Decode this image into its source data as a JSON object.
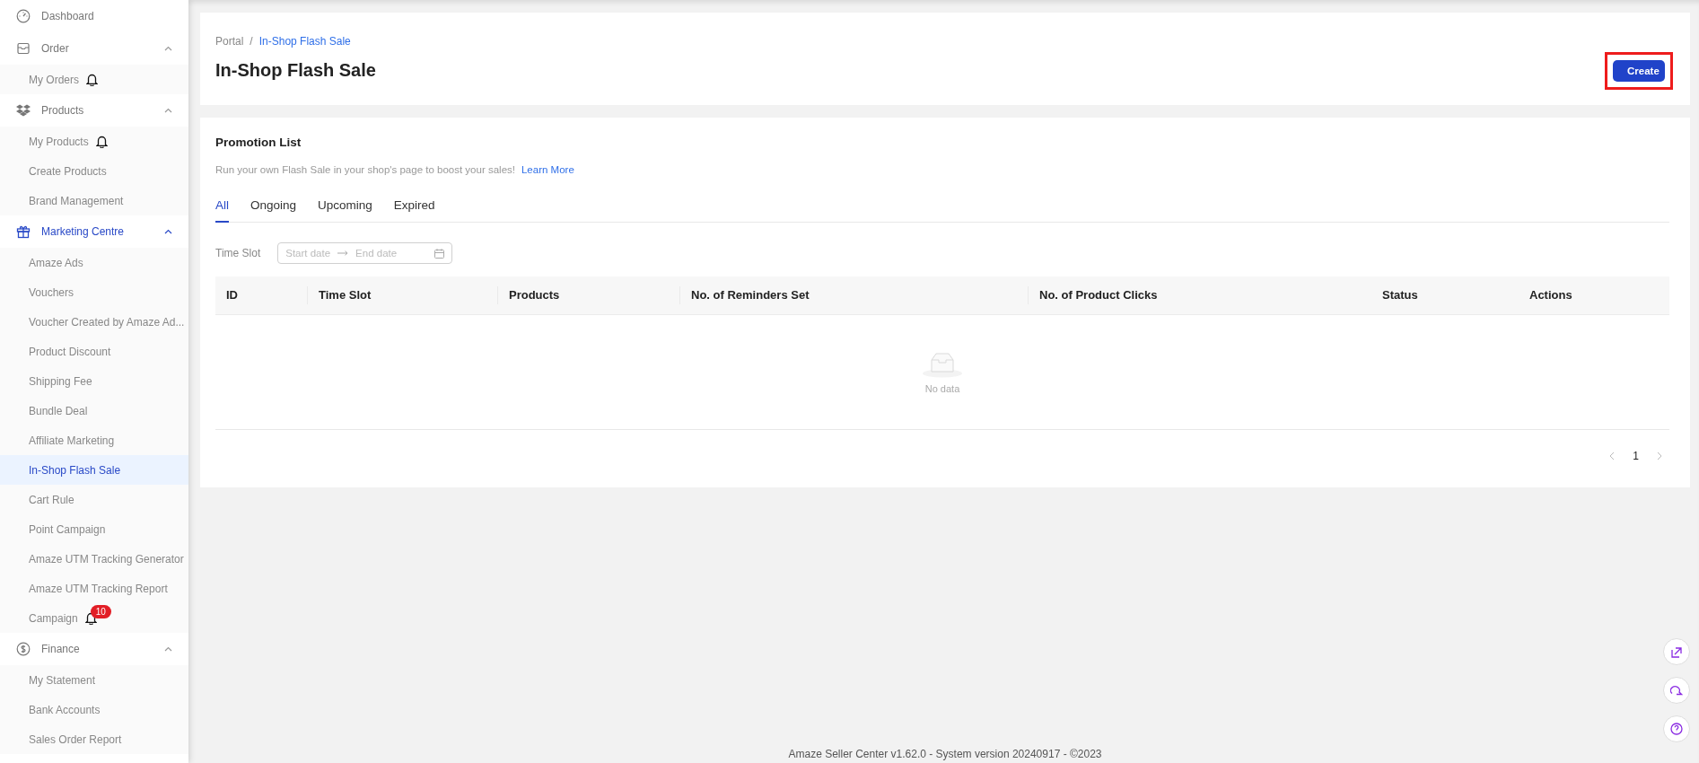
{
  "sidebar": {
    "items": [
      {
        "label": "Dashboard",
        "active": false
      },
      {
        "label": "Order",
        "expanded": true,
        "active": false,
        "children": [
          {
            "label": "My Orders",
            "selected": false,
            "bell": true
          }
        ]
      },
      {
        "label": "Products",
        "expanded": true,
        "active": false,
        "children": [
          {
            "label": "My Products",
            "selected": false,
            "bell": true
          },
          {
            "label": "Create Products",
            "selected": false,
            "bell": false
          },
          {
            "label": "Brand Management",
            "selected": false,
            "bell": false
          }
        ]
      },
      {
        "label": "Marketing Centre",
        "expanded": true,
        "active": true,
        "children": [
          {
            "label": "Amaze Ads",
            "selected": false,
            "bell": false
          },
          {
            "label": "Vouchers",
            "selected": false,
            "bell": false
          },
          {
            "label": "Voucher Created by Amaze Ad...",
            "selected": false,
            "bell": false
          },
          {
            "label": "Product Discount",
            "selected": false,
            "bell": false
          },
          {
            "label": "Shipping Fee",
            "selected": false,
            "bell": false
          },
          {
            "label": "Bundle Deal",
            "selected": false,
            "bell": false
          },
          {
            "label": "Affiliate Marketing",
            "selected": false,
            "bell": false
          },
          {
            "label": "In-Shop Flash Sale",
            "selected": true,
            "bell": false
          },
          {
            "label": "Cart Rule",
            "selected": false,
            "bell": false
          },
          {
            "label": "Point Campaign",
            "selected": false,
            "bell": false
          },
          {
            "label": "Amaze UTM Tracking Generator",
            "selected": false,
            "bell": false
          },
          {
            "label": "Amaze UTM Tracking Report",
            "selected": false,
            "bell": false
          },
          {
            "label": "Campaign",
            "selected": false,
            "bell": true,
            "badge": "10"
          }
        ]
      },
      {
        "label": "Finance",
        "expanded": true,
        "active": false,
        "children": [
          {
            "label": "My Statement",
            "selected": false,
            "bell": false
          },
          {
            "label": "Bank Accounts",
            "selected": false,
            "bell": false
          },
          {
            "label": "Sales Order Report",
            "selected": false,
            "bell": false
          }
        ]
      }
    ]
  },
  "header": {
    "breadcrumb": [
      "Portal",
      "In-Shop Flash Sale"
    ],
    "breadcrumb_separator": "/",
    "title": "In-Shop Flash Sale",
    "create_button": {
      "label": "Create",
      "highlighted": true
    }
  },
  "promotion_list": {
    "title": "Promotion List",
    "description": "Run your own Flash Sale in your shop's page to boost your sales!",
    "link": "Learn More",
    "tabs": [
      {
        "label": "All",
        "selected": true
      },
      {
        "label": "Ongoing",
        "selected": false
      },
      {
        "label": "Upcoming",
        "selected": false
      },
      {
        "label": "Expired",
        "selected": false
      }
    ],
    "filter": {
      "label": "Time Slot",
      "start_placeholder": "Start date",
      "end_placeholder": "End date"
    },
    "table": {
      "columns": [
        "ID",
        "Time Slot",
        "Products",
        "No. of Reminders Set",
        "No. of Product Clicks",
        "Status",
        "Actions"
      ],
      "empty_text": "No data"
    },
    "pagination": {
      "pages": [
        {
          "label": "1",
          "selected": true
        }
      ]
    }
  },
  "footer": "Amaze Seller Center v1.62.0 - System version 20240917 - ©2023"
}
